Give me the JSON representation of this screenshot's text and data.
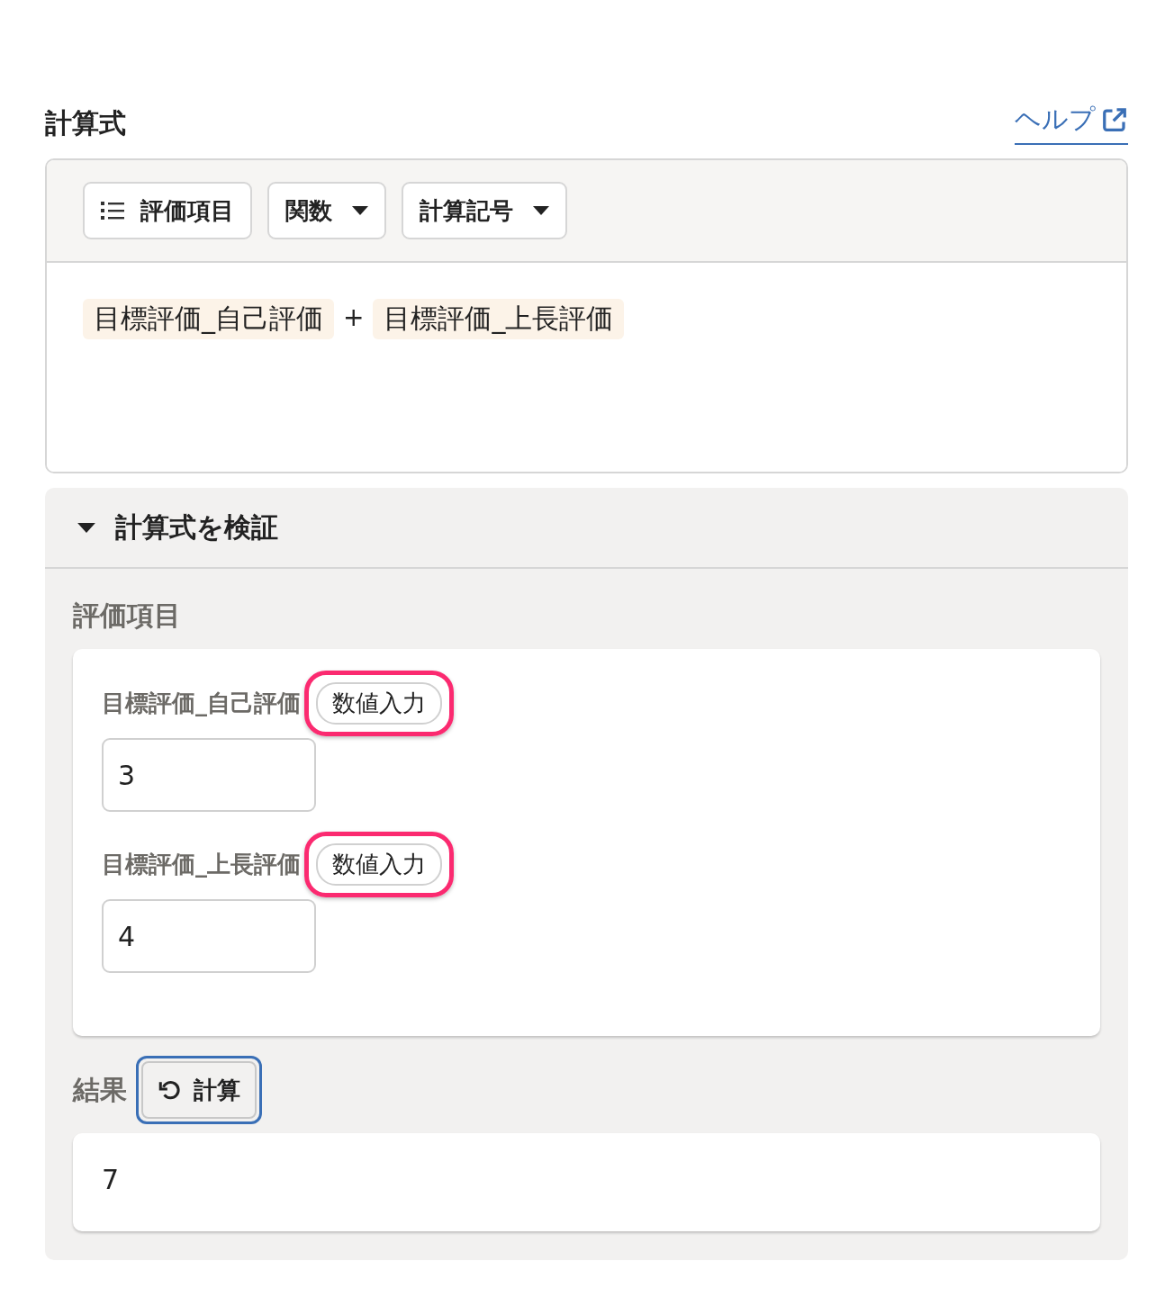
{
  "header": {
    "title": "計算式",
    "help_link": "ヘルプ"
  },
  "toolbar": [
    {
      "kind": "list",
      "label": "評価項目"
    },
    {
      "kind": "dropdown",
      "label": "関数"
    },
    {
      "kind": "dropdown",
      "label": "計算記号"
    }
  ],
  "formula": [
    {
      "kind": "token",
      "text": "目標評価_自己評価"
    },
    {
      "kind": "operator",
      "text": "+"
    },
    {
      "kind": "token",
      "text": "目標評価_上長評価"
    }
  ],
  "verify": {
    "title": "計算式を検証",
    "expanded": true,
    "items_heading": "評価項目",
    "items": [
      {
        "label": "目標評価_自己評価",
        "badge": "数値入力",
        "highlighted": true,
        "value": "3"
      },
      {
        "label": "目標評価_上長評価",
        "badge": "数値入力",
        "highlighted": true,
        "value": "4"
      }
    ],
    "result_label": "結果",
    "calc_button": {
      "label": "計算",
      "focused": true
    },
    "result": "7"
  }
}
